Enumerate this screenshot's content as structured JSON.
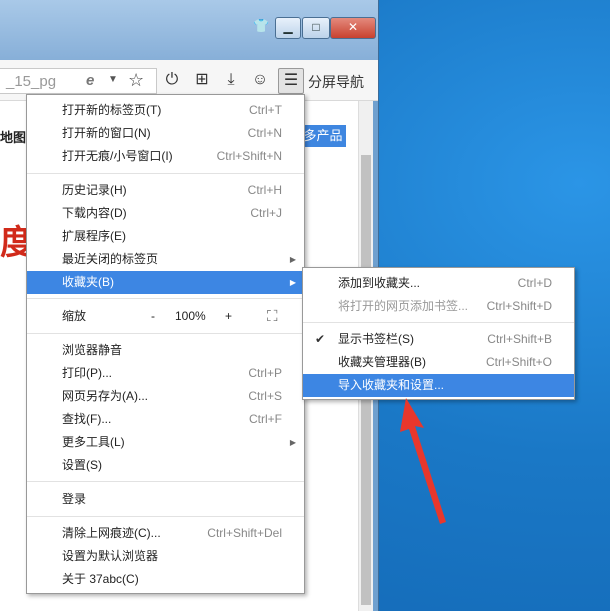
{
  "window": {
    "controls": {
      "skin": "skin-icon",
      "minimize": "▁",
      "maximize": "□",
      "close": "✕"
    }
  },
  "toolbar": {
    "address_text": "_15_pg",
    "icons": [
      "ie-icon",
      "dropdown-icon",
      "star-icon",
      "power-icon",
      "apps-icon",
      "download-icon",
      "user-icon",
      "menu-icon"
    ],
    "split_label": "分屏导航"
  },
  "page": {
    "link1": "地图",
    "link2": "多产品",
    "big_char": "度"
  },
  "menu": {
    "items": [
      {
        "label": "打开新的标签页(T)",
        "shortcut": "Ctrl+T"
      },
      {
        "label": "打开新的窗口(N)",
        "shortcut": "Ctrl+N"
      },
      {
        "label": "打开无痕/小号窗口(I)",
        "shortcut": "Ctrl+Shift+N"
      },
      {
        "label": "历史记录(H)",
        "shortcut": "Ctrl+H"
      },
      {
        "label": "下载内容(D)",
        "shortcut": "Ctrl+J"
      },
      {
        "label": "扩展程序(E)",
        "shortcut": ""
      },
      {
        "label": "最近关闭的标签页",
        "shortcut": ""
      },
      {
        "label": "收藏夹(B)",
        "shortcut": ""
      },
      {
        "label": "浏览器静音",
        "shortcut": ""
      },
      {
        "label": "打印(P)...",
        "shortcut": "Ctrl+P"
      },
      {
        "label": "网页另存为(A)...",
        "shortcut": "Ctrl+S"
      },
      {
        "label": "查找(F)...",
        "shortcut": "Ctrl+F"
      },
      {
        "label": "更多工具(L)",
        "shortcut": ""
      },
      {
        "label": "设置(S)",
        "shortcut": ""
      },
      {
        "label": "登录",
        "shortcut": ""
      },
      {
        "label": "清除上网痕迹(C)...",
        "shortcut": "Ctrl+Shift+Del"
      },
      {
        "label": "设置为默认浏览器",
        "shortcut": ""
      },
      {
        "label": "关于 37abc(C)",
        "shortcut": ""
      }
    ],
    "zoom": {
      "label": "缩放",
      "minus": "-",
      "value": "100%",
      "plus": "+",
      "fullscreen": "⛶"
    }
  },
  "submenu": {
    "items": [
      {
        "label": "添加到收藏夹...",
        "shortcut": "Ctrl+D"
      },
      {
        "label": "将打开的网页添加书签...",
        "shortcut": "Ctrl+Shift+D"
      },
      {
        "label": "显示书签栏(S)",
        "shortcut": "Ctrl+Shift+B"
      },
      {
        "label": "收藏夹管理器(B)",
        "shortcut": "Ctrl+Shift+O"
      },
      {
        "label": "导入收藏夹和设置...",
        "shortcut": ""
      }
    ]
  },
  "colors": {
    "highlight": "#3d86e3",
    "annotation_arrow": "#e8372c"
  }
}
